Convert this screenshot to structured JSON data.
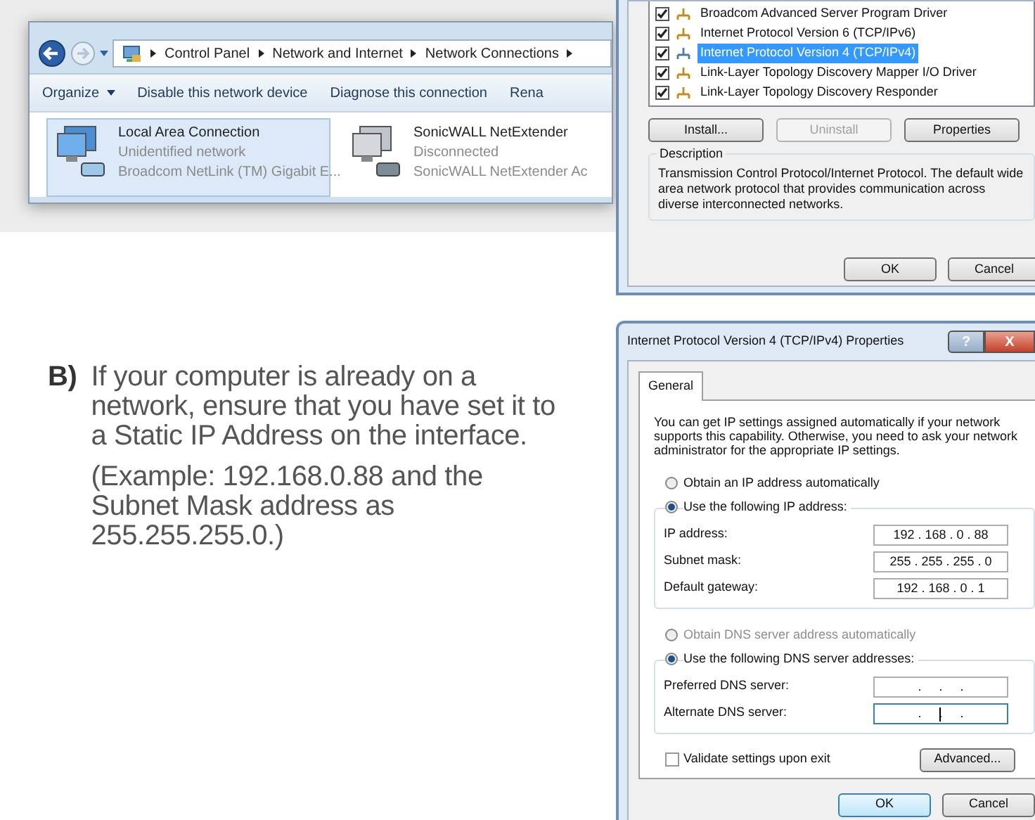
{
  "explorer": {
    "breadcrumb": [
      "Control Panel",
      "Network and Internet",
      "Network Connections"
    ],
    "toolbar": [
      {
        "label": "Organize",
        "kind": "menu"
      },
      {
        "label": "Disable this network device",
        "kind": "plain"
      },
      {
        "label": "Diagnose this connection",
        "kind": "plain"
      },
      {
        "label": "Rena",
        "kind": "plain"
      }
    ],
    "connections": [
      {
        "name": "Local Area Connection",
        "status": "Unidentified network",
        "adapter": "Broadcom NetLink (TM) Gigabit E...",
        "selected": true
      },
      {
        "name": "SonicWALL NetExtender",
        "status": "Disconnected",
        "adapter": "SonicWALL NetExtender Ac",
        "selected": false
      }
    ]
  },
  "instruction": {
    "marker": "B)",
    "text": "If your computer is already on a network, ensure that you have set it to a Static IP Address on the interface.",
    "example": "(Example: 192.168.0.88 and the Subnet Mask address as 255.255.255.0.)"
  },
  "connection_properties": {
    "items": [
      {
        "label": "Broadcom Advanced Server Program Driver",
        "checked": true,
        "selected": false
      },
      {
        "label": "Internet Protocol Version 6 (TCP/IPv6)",
        "checked": true,
        "selected": false
      },
      {
        "label": "Internet Protocol Version 4 (TCP/IPv4)",
        "checked": true,
        "selected": true
      },
      {
        "label": "Link-Layer Topology Discovery Mapper I/O Driver",
        "checked": true,
        "selected": false
      },
      {
        "label": "Link-Layer Topology Discovery Responder",
        "checked": true,
        "selected": false
      }
    ],
    "buttons": [
      {
        "label": "Install...",
        "disabled": false
      },
      {
        "label": "Uninstall",
        "disabled": true
      },
      {
        "label": "Properties",
        "disabled": false
      }
    ],
    "description": {
      "title": "Description",
      "text": "Transmission Control Protocol/Internet Protocol. The default wide area network protocol that provides communication across diverse interconnected networks."
    },
    "footer_buttons": [
      {
        "label": "OK",
        "default": false
      },
      {
        "label": "Cancel",
        "default": false
      }
    ]
  },
  "ipv4_properties": {
    "title": "Internet Protocol Version 4 (TCP/IPv4) Properties",
    "title_buttons": [
      {
        "label": "?",
        "kind": "help"
      },
      {
        "label": "X",
        "kind": "close"
      }
    ],
    "tabs": [
      {
        "label": "General",
        "selected": true
      }
    ],
    "intro": "You can get IP settings assigned automatically if your network supports this capability. Otherwise, you need to ask your network administrator for the appropriate IP settings.",
    "ip_options": [
      {
        "label": "Obtain an IP address automatically",
        "selected": false,
        "disabled": false
      },
      {
        "label": "Use the following IP address:",
        "selected": true,
        "disabled": false
      }
    ],
    "ip_fields": [
      {
        "label": "IP address:",
        "value": "192 . 168 . 0 . 88",
        "focused": false
      },
      {
        "label": "Subnet mask:",
        "value": "255 . 255 . 255 . 0",
        "focused": false
      },
      {
        "label": "Default gateway:",
        "value": "192 . 168 . 0 . 1",
        "focused": false
      }
    ],
    "dns_options": [
      {
        "label": "Obtain DNS server address automatically",
        "selected": false,
        "disabled": true
      },
      {
        "label": "Use the following DNS server addresses:",
        "selected": true,
        "disabled": false
      }
    ],
    "dns_fields": [
      {
        "label": "Preferred DNS server:",
        "value": ".     .     .",
        "focused": false
      },
      {
        "label": "Alternate DNS server:",
        "value": ".     .     .",
        "focused": true
      }
    ],
    "validate": {
      "label": "Validate settings upon exit",
      "checked": false
    },
    "advanced": "Advanced...",
    "footer_buttons": [
      {
        "label": "OK",
        "default": true
      },
      {
        "label": "Cancel",
        "default": false
      }
    ]
  }
}
